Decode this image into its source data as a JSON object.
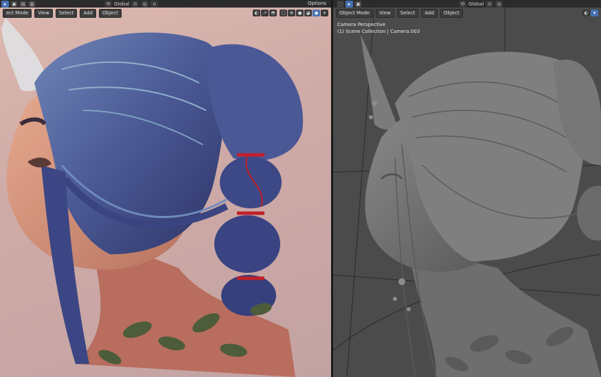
{
  "topbar": {
    "orientation": "Global",
    "options_label": "Options",
    "right_orientation": "Global"
  },
  "left_viewport": {
    "mode": "ect Mode",
    "menus": [
      "View",
      "Select",
      "Add",
      "Object"
    ]
  },
  "right_viewport": {
    "mode": "Object Mode",
    "menus": [
      "View",
      "Select",
      "Add",
      "Object"
    ],
    "camera_label": "Camera Perspective",
    "collection_label": "(1) Scene Collection | Camera.003"
  },
  "colors": {
    "accent": "#4772b3",
    "header": "#2b2b2b",
    "hair": "#4a5a96",
    "skin": "#d79a82",
    "ribbon": "#c0202a",
    "clay": "#6a6a6a"
  },
  "icons": [
    "cursor-icon",
    "snap-icon",
    "proportional-icon",
    "shading-icon",
    "overlay-icon",
    "gizmo-icon",
    "filter-icon"
  ]
}
